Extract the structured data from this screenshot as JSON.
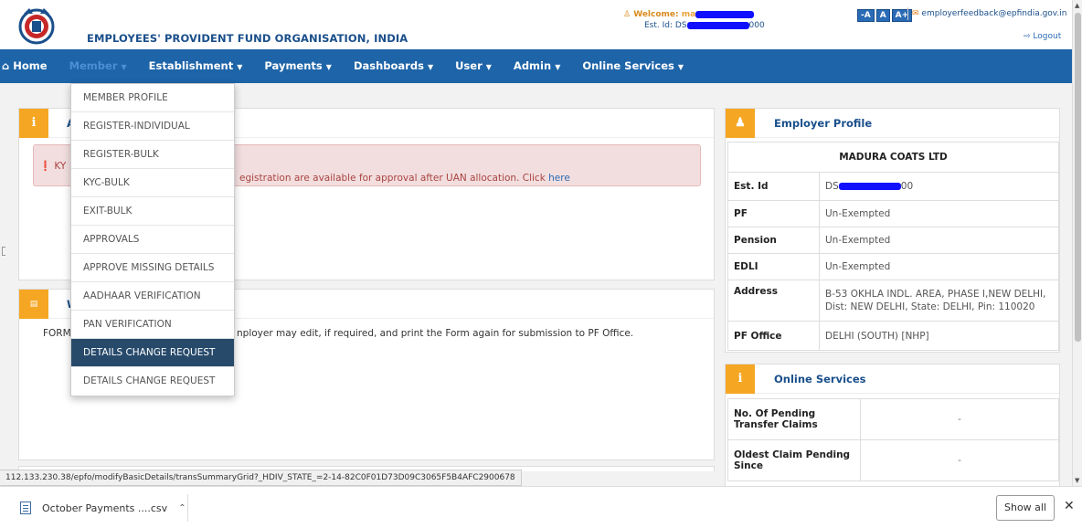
{
  "header": {
    "org_title": "EMPLOYEES' PROVIDENT FUND ORGANISATION, INDIA",
    "welcome_label": "Welcome:",
    "welcome_name": "ma",
    "est_id_label": "Est. Id: DS",
    "est_id_suffix": "000",
    "font_buttons": [
      "-A",
      "A",
      "A+"
    ],
    "feedback_email": "employerfeedback@epfindia.gov.in",
    "logout": "Logout"
  },
  "nav": {
    "items": [
      {
        "label": "Home",
        "icon": "home-icon"
      },
      {
        "label": "Member",
        "caret": true
      },
      {
        "label": "Establishment",
        "caret": true
      },
      {
        "label": "Payments",
        "caret": true
      },
      {
        "label": "Dashboards",
        "caret": true
      },
      {
        "label": "User",
        "caret": true
      },
      {
        "label": "Admin",
        "caret": true
      },
      {
        "label": "Online Services",
        "caret": true
      }
    ]
  },
  "member_menu": {
    "items": [
      "MEMBER PROFILE",
      "REGISTER-INDIVIDUAL",
      "REGISTER-BULK",
      "KYC-BULK",
      "EXIT-BULK",
      "APPROVALS",
      "APPROVE MISSING DETAILS",
      "AADHAAR VERIFICATION",
      "PAN VERIFICATION",
      "DETAILS CHANGE REQUEST",
      "DETAILS CHANGE REQUEST"
    ],
    "selected_index": 9
  },
  "alerts_panel": {
    "title_fragment": "A",
    "alert_prefix": "KY",
    "alert_text": "egistration are available for approval after UAN allocation. Click",
    "alert_link": "here"
  },
  "forms_panel": {
    "title_fragment": "W",
    "text_prefix": "FORM",
    "text": "nployer may edit, if required, and print the Form again for submission to PF Office."
  },
  "employer_profile": {
    "title": "Employer Profile",
    "company": "MADURA COATS LTD",
    "rows": [
      {
        "key": "Est. Id",
        "value": "DS",
        "value_suffix": "00"
      },
      {
        "key": "PF",
        "value": "Un-Exempted"
      },
      {
        "key": "Pension",
        "value": "Un-Exempted"
      },
      {
        "key": "EDLI",
        "value": "Un-Exempted"
      },
      {
        "key": "Address",
        "value": "B-53 OKHLA INDL. AREA, PHASE I,NEW DELHI, Dist: NEW DELHI, State: DELHI, Pin: 110020"
      },
      {
        "key": "PF Office",
        "value": "DELHI (SOUTH) [NHP]"
      }
    ]
  },
  "online_services": {
    "title": "Online Services",
    "rows": [
      {
        "key": "No. Of Pending Transfer Claims",
        "value": "-"
      },
      {
        "key": "Oldest Claim Pending Since",
        "value": "-"
      }
    ]
  },
  "status_url": "112.133.230.38/epfo/modifyBasicDetails/transSummaryGrid?_HDIV_STATE_=2-14-82C0F01D73D09C3065F5B4AFC2900678",
  "download_bar": {
    "file_name": "October Payments ....csv",
    "show_all": "Show all",
    "close": "✕"
  },
  "colors": {
    "nav_bg": "#1e64a8",
    "accent_orange": "#f5a623",
    "selected_menu": "#274a6b",
    "alert_bg": "#f2dede"
  }
}
